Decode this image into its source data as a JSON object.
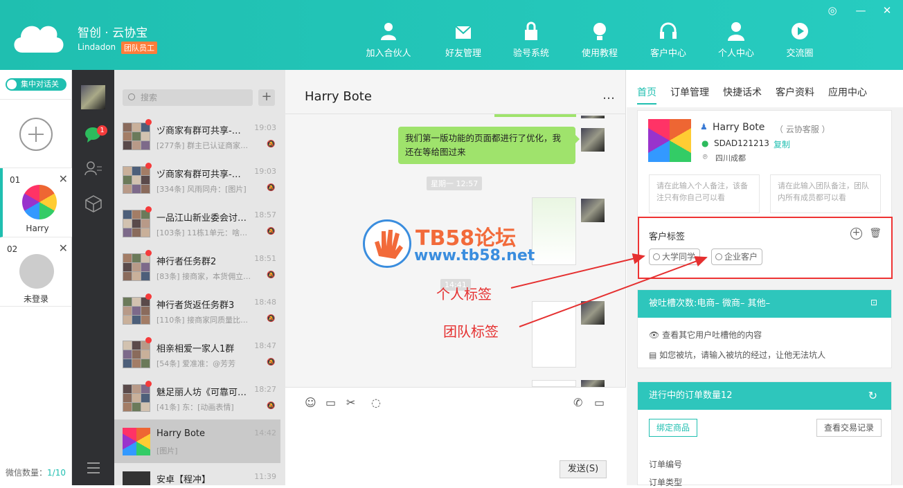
{
  "app": {
    "title": "智创 · 云协宝",
    "user": "Lindadon",
    "badge": "团队员工"
  },
  "nav": [
    {
      "label": "加入合伙人",
      "icon": "user-add-icon"
    },
    {
      "label": "好友管理",
      "icon": "friends-inbox-icon"
    },
    {
      "label": "验号系统",
      "icon": "lock-icon"
    },
    {
      "label": "使用教程",
      "icon": "lightbulb-icon"
    },
    {
      "label": "客户中心",
      "icon": "headset-icon"
    },
    {
      "label": "个人中心",
      "icon": "user-icon"
    },
    {
      "label": "交流圈",
      "icon": "play-circle-icon"
    }
  ],
  "window": {
    "settings": "◎",
    "minimize": "—",
    "close": "✕"
  },
  "accounts": {
    "toggle": "集中对话关",
    "items": [
      {
        "num": "01",
        "name": "Harry"
      },
      {
        "num": "02",
        "name": "未登录"
      }
    ],
    "wx_label": "微信数量：",
    "wx_value": "1/10"
  },
  "sidebar": {
    "badge": "1"
  },
  "chatlist": {
    "search_placeholder": "搜索",
    "add": "+",
    "items": [
      {
        "title": "ヅ商家有群可共享-…",
        "time": "19:03",
        "sub": "[277条] 群主已认证商家…"
      },
      {
        "title": "ヅ商家有群可共享-…",
        "time": "19:03",
        "sub": "[334条] 风雨同舟：[图片]"
      },
      {
        "title": "一品江山新业委会讨…",
        "time": "18:57",
        "sub": "[103条] 11栋1单元：啥…"
      },
      {
        "title": "神行者任务群2",
        "time": "18:51",
        "sub": "[83条] 接商家，本货佣立…"
      },
      {
        "title": "神行者货返任务群3",
        "time": "18:48",
        "sub": "[110条] 接商家同质量比…"
      },
      {
        "title": "相亲相爱一家人1群",
        "time": "18:47",
        "sub": "[54条] 爱准准：@芳芳"
      },
      {
        "title": "魅足丽人坊《可靠可…",
        "time": "18:27",
        "sub": "[41条] 东：[动画表情]"
      },
      {
        "title": "Harry Bote",
        "time": "14:42",
        "sub": "[图片]"
      },
      {
        "title": "安卓【程冲】",
        "time": "11:39",
        "sub": ""
      }
    ]
  },
  "chat": {
    "name": "Harry Bote",
    "more": "…",
    "message": "我们第一版功能的页面都进行了优化，我还在等给图过来",
    "date_chip": "星期一 12:57",
    "time_chip": "14:41",
    "send": "发送(S)"
  },
  "watermark": {
    "title": "TB58论坛",
    "url": "www.tb58.net"
  },
  "annotations": {
    "personal": "个人标签",
    "team": "团队标签"
  },
  "right": {
    "tabs": [
      "首页",
      "订单管理",
      "快捷话术",
      "客户资料",
      "应用中心"
    ],
    "customer": {
      "name": "Harry Bote",
      "role": "（ 云协客服 ）",
      "wechat": "SDAD121213",
      "copy": "复制",
      "location": "四川成都"
    },
    "notes": {
      "personal": "请在此输入个人备注，该备注只有你自己可以看",
      "team": "请在此输入团队备注，团队内所有成员都可以看"
    },
    "tags": {
      "label": "客户标签",
      "items": [
        "大学同学",
        "企业客户"
      ]
    },
    "tucao": {
      "header": "被吐槽次数:电商–   微商–   其他–",
      "line1": "查看其它用户吐槽他的内容",
      "line2": "如您被坑，请输入被坑的经过，让他无法坑人"
    },
    "orders": {
      "header": "进行中的订单数量12",
      "bind": "绑定商品",
      "records": "查看交易记录",
      "no": "订单编号",
      "type": "订单类型"
    }
  },
  "colors": {
    "brand": "#1fbfb0",
    "red": "#ee3333",
    "bubble": "#9fe36c"
  }
}
